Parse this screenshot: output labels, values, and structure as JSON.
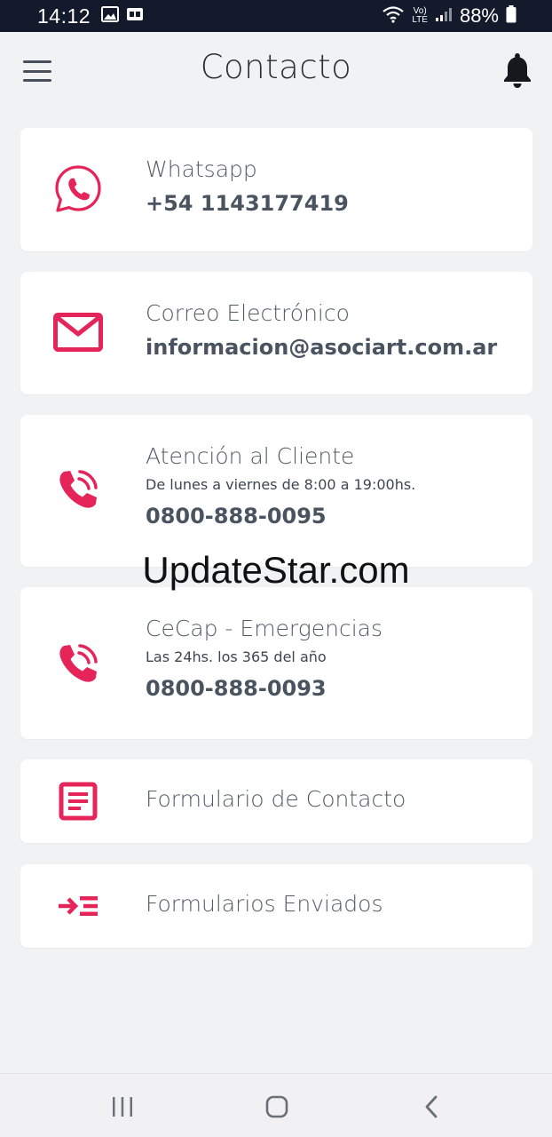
{
  "status_bar": {
    "time": "14:12",
    "battery": "88%",
    "network": "LTE",
    "icons": [
      "image-icon",
      "gallery-icon",
      "wifi-icon",
      "volte-icon",
      "signal-icon",
      "battery-icon"
    ]
  },
  "header": {
    "title": "Contacto",
    "icons": [
      "menu-icon",
      "bell-icon"
    ]
  },
  "contacts": [
    {
      "icon": "whatsapp-icon",
      "title": "Whatsapp",
      "value": "+54 1143177419"
    },
    {
      "icon": "mail-icon",
      "title": "Correo Electrónico",
      "value": "informacion@asociart.com.ar"
    },
    {
      "icon": "phone-ringing-icon",
      "title": "Atención al Cliente",
      "subtitle": "De lunes a viernes de 8:00 a 19:00hs.",
      "value": "0800-888-0095"
    },
    {
      "icon": "phone-ringing-icon",
      "title": "CeCap - Emergencias",
      "subtitle": "Las 24hs. los 365 del año",
      "value": "0800-888-0093"
    }
  ],
  "forms": [
    {
      "icon": "form-icon",
      "title": "Formulario de Contacto"
    },
    {
      "icon": "sent-forms-icon",
      "title": "Formularios Enviados"
    }
  ],
  "watermark": "UpdateStar.com",
  "nav_bar": {
    "icons": [
      "recent-apps-icon",
      "home-icon",
      "back-icon"
    ]
  },
  "colors": {
    "accent": "#e5245a",
    "status_bar": "#121a2b",
    "background": "#f1f2f4",
    "card": "#ffffff"
  }
}
